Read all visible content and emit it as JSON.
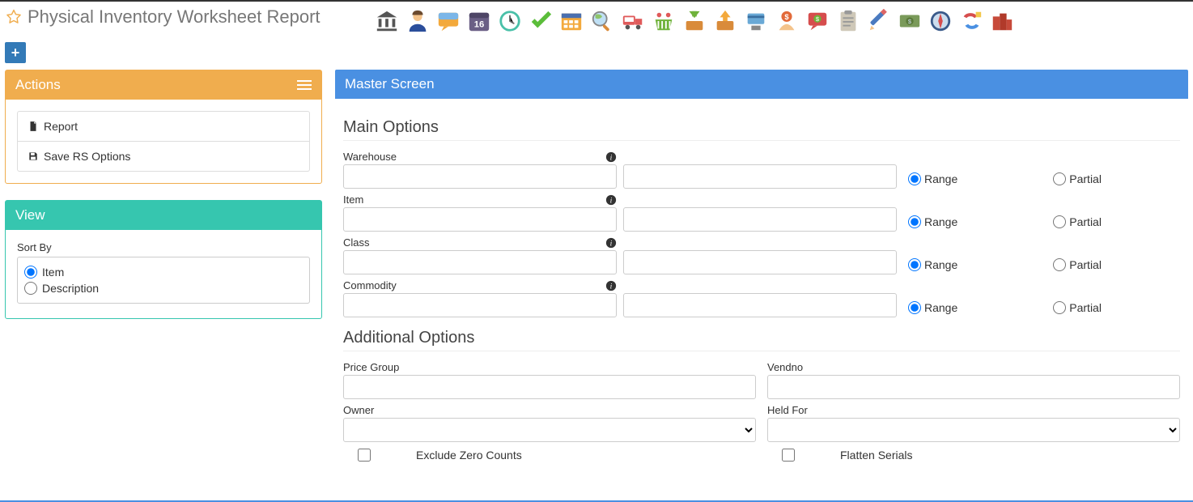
{
  "page_title": "Physical Inventory Worksheet Report",
  "toolbar_icons": [
    "bank-icon",
    "user-icon",
    "chat-icon",
    "calendar-16-icon",
    "clock-icon",
    "check-icon",
    "schedule-icon",
    "globe-search-icon",
    "truck-icon",
    "basket-icon",
    "download-box-icon",
    "upload-box-icon",
    "card-reader-icon",
    "donate-icon",
    "clipboard-icon",
    "pencil-icon",
    "cash-icon",
    "compass-icon",
    "refresh-icon",
    "buildings-icon"
  ],
  "actions": {
    "title": "Actions",
    "items": {
      "report": "Report",
      "save_rs": "Save RS Options"
    }
  },
  "view": {
    "title": "View",
    "sort_by_label": "Sort By",
    "options": {
      "item": "Item",
      "description": "Description"
    },
    "selected": "item"
  },
  "screen": {
    "title": "Master Screen",
    "main_options_heading": "Main Options",
    "additional_options_heading": "Additional Options",
    "range_label": "Range",
    "partial_label": "Partial",
    "rows": {
      "warehouse": {
        "label": "Warehouse",
        "from": "",
        "to": "",
        "mode": "range"
      },
      "item": {
        "label": "Item",
        "from": "",
        "to": "",
        "mode": "range"
      },
      "class": {
        "label": "Class",
        "from": "",
        "to": "",
        "mode": "range"
      },
      "commodity": {
        "label": "Commodity",
        "from": "",
        "to": "",
        "mode": "range"
      }
    },
    "additional": {
      "price_group": {
        "label": "Price Group",
        "value": ""
      },
      "vendno": {
        "label": "Vendno",
        "value": ""
      },
      "owner": {
        "label": "Owner",
        "value": ""
      },
      "held_for": {
        "label": "Held For",
        "value": ""
      }
    },
    "checks": {
      "exclude_zero": {
        "label": "Exclude Zero Counts",
        "checked": false
      },
      "flatten_serials": {
        "label": "Flatten Serials",
        "checked": false
      }
    }
  }
}
